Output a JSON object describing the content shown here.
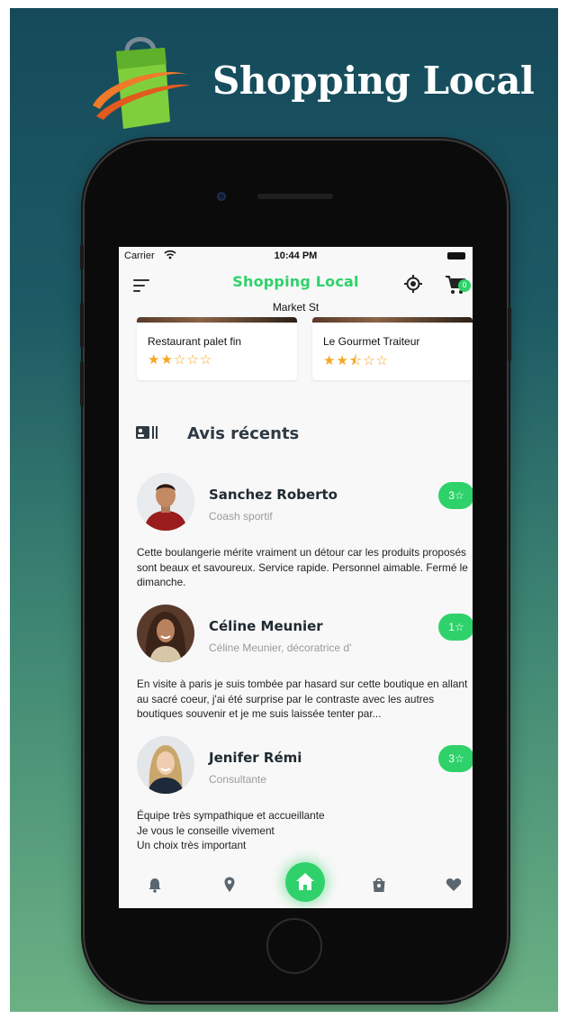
{
  "brand": {
    "title": "Shopping Local",
    "logo_icon": "shopping-bag-logo"
  },
  "status_bar": {
    "carrier": "Carrier",
    "time": "10:44 PM"
  },
  "app_bar": {
    "title": "Shopping Local",
    "subtitle": "Market St",
    "menu_icon": "menu-icon",
    "location_icon": "gps-target-icon",
    "cart_icon": "cart-icon",
    "cart_count": "0"
  },
  "featured": [
    {
      "name": "Restaurant palet fin",
      "rating": 2,
      "stars": "★★☆☆☆"
    },
    {
      "name": "Le Gourmet Traiteur",
      "rating": 2.5,
      "stars": "★★⯪☆☆"
    }
  ],
  "recent_reviews": {
    "title": "Avis récents",
    "icon": "contact-card-icon",
    "items": [
      {
        "name": "Sanchez Roberto",
        "role": "Coash sportif",
        "rating": "3☆",
        "text": "Cette boulangerie mérite vraiment un détour car les produits proposés sont beaux et savoureux. Service rapide. Personnel aimable. Fermé le dimanche."
      },
      {
        "name": "Céline Meunier",
        "role": "Céline Meunier, décoratrice d'",
        "rating": "1☆",
        "text": "En visite à paris je suis tombée par hasard sur cette boutique en allant au sacré coeur, j'ai été surprise par le contraste avec les autres boutiques souvenir et je me suis laissée tenter par..."
      },
      {
        "name": "Jenifer Rémi",
        "role": "Consultante",
        "rating": "3☆",
        "text": "Équipe très sympathique et accueillante\nJe vous le conseille vivement\nUn choix très important"
      }
    ]
  },
  "bottom_nav": {
    "items": [
      "bell-icon",
      "location-pin-icon",
      "home-icon",
      "bag-icon",
      "heart-icon"
    ],
    "active": "home-icon"
  },
  "colors": {
    "accent": "#2fd26a",
    "star": "#f5a623",
    "background_top": "#154a5b",
    "background_bottom": "#6bb184"
  }
}
